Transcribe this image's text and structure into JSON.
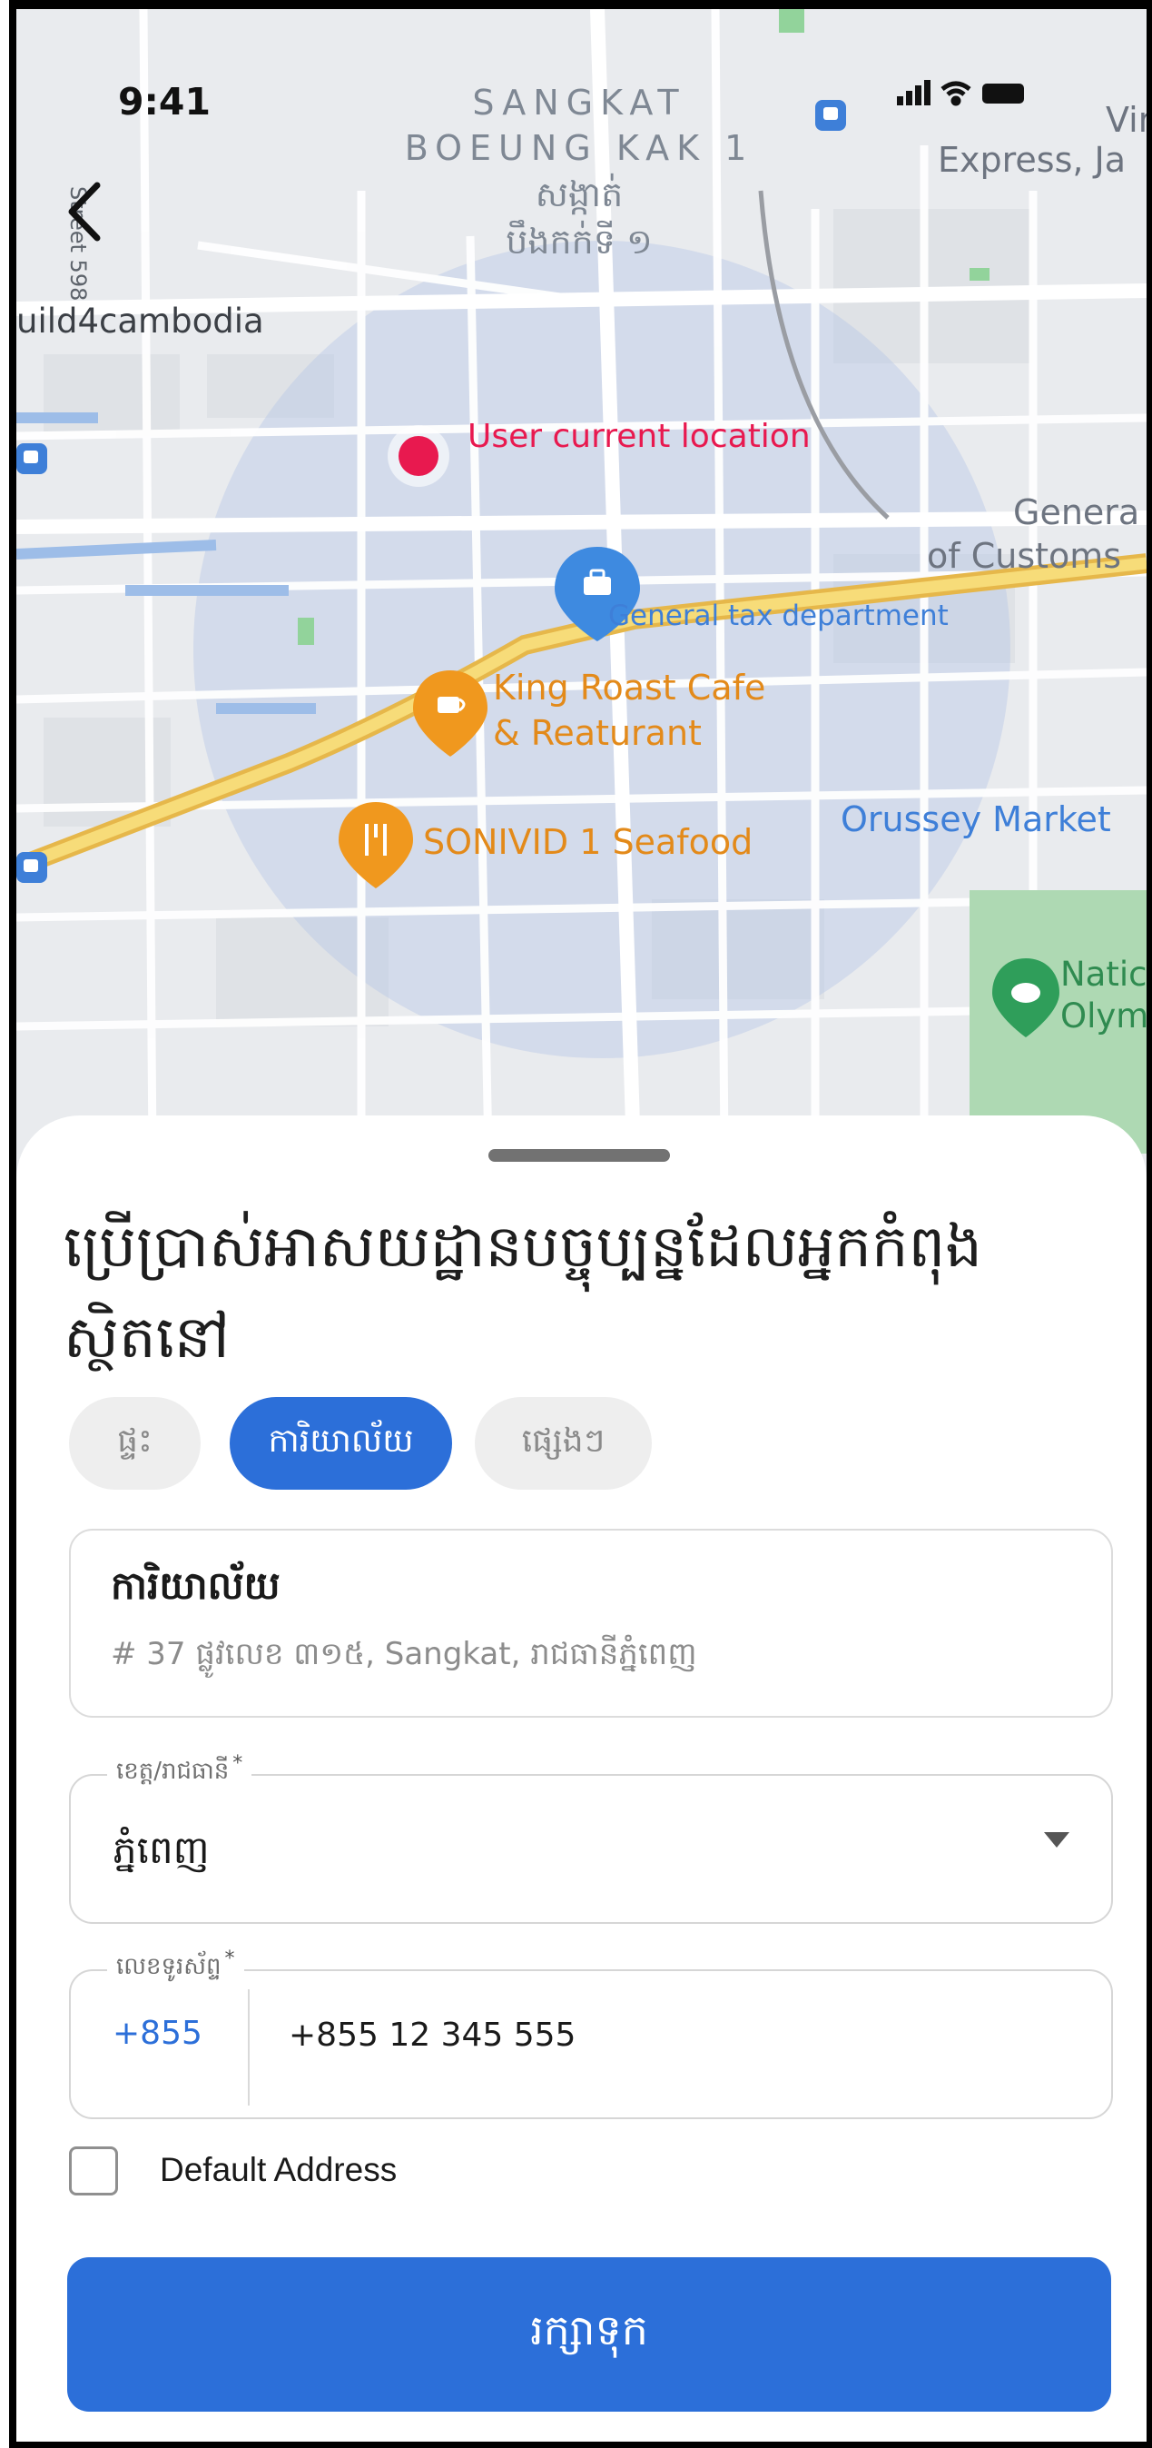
{
  "status_bar": {
    "time": "9:41"
  },
  "map": {
    "district_lines": [
      "SANGKAT",
      "BOEUNG KAK 1",
      "សង្កាត់",
      "បឹងកក់ទី ១"
    ],
    "street_label": "Street 598",
    "build_label": "uild4cambodia",
    "user_location_label": "User current location",
    "vireak_label_line1": "Vir",
    "vireak_label_line2": "Express, Ja",
    "customs_label_line1": "Genera",
    "customs_label_line2": "of Customs",
    "tax_label": "General tax department",
    "cafe_label_line1": "King Roast Cafe",
    "cafe_label_line2": "& Reaturant",
    "seafood_label": "SONIVID 1 Seafood",
    "market_label": "Orussey Market",
    "olympic_label_line1": "Natic",
    "olympic_label_line2": "Olym",
    "colors": {
      "user_dot": "#e8194f",
      "pin_blue": "#3e8ae0",
      "pin_orange": "#f0981e",
      "road_yellow": "#f3cf5c",
      "park_green": "#aed9b3"
    }
  },
  "sheet": {
    "title": "ប្រើប្រាស់អាសយដ្ឋានបច្ចុប្បន្នដែលអ្នកកំពុងស្ថិតនៅ",
    "chips": [
      {
        "label": "ផ្ទះ",
        "active": false
      },
      {
        "label": "ការិយាល័យ",
        "active": true
      },
      {
        "label": "ផ្សេងៗ",
        "active": false
      }
    ],
    "address_card": {
      "title": "ការិយាល័យ",
      "subtitle": "# 37 ផ្លូវលេខ ៣១៥, Sangkat, រាជធានីភ្នំពេញ"
    },
    "province_field": {
      "label": "ខេត្ត/រាជធានី",
      "required_mark": "*",
      "value": "ភ្នំពេញ"
    },
    "phone_field": {
      "label": "លេខទូរស័ព្ទ",
      "required_mark": "*",
      "prefix": "+855",
      "value": "+855 12 345 555"
    },
    "default_checkbox": {
      "label": "Default Address",
      "checked": false
    },
    "save_button": {
      "label": "រក្សាទុក"
    }
  }
}
